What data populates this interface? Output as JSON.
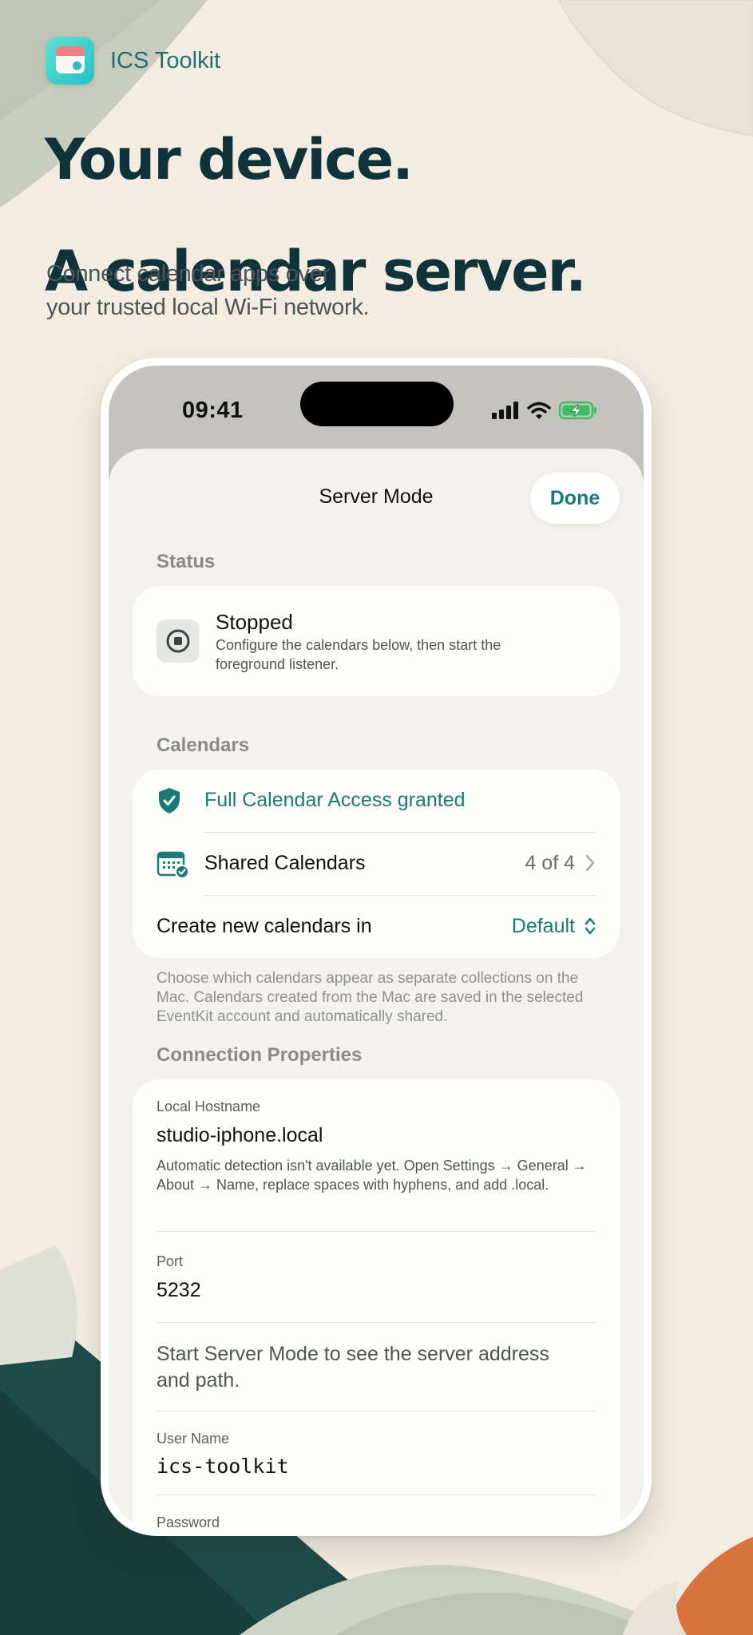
{
  "app": {
    "name": "ICS Toolkit"
  },
  "headline": {
    "line1": "Your device.",
    "line2": "A calendar server."
  },
  "subline": {
    "line1": "Connect calendar apps over",
    "line2": "your trusted local Wi-Fi network."
  },
  "statusbar": {
    "time": "09:41"
  },
  "nav": {
    "title": "Server Mode",
    "done_label": "Done"
  },
  "status_section": {
    "label": "Status",
    "title": "Stopped",
    "description": "Configure the calendars below, then start the foreground listener."
  },
  "calendars_section": {
    "label": "Calendars",
    "access_label": "Full Calendar Access granted",
    "shared_label": "Shared Calendars",
    "shared_value": "4 of 4",
    "create_label": "Create new calendars in",
    "create_value": "Default",
    "footnote": "Choose which calendars appear as separate collections on the Mac. Calendars created from the Mac are saved in the selected EventKit account and automatically shared."
  },
  "connection_section": {
    "label": "Connection Properties",
    "hostname_label": "Local Hostname",
    "hostname_value": "studio-iphone.local",
    "hostname_help": "Automatic detection isn't available yet. Open Settings → General → About → Name, replace spaces with hyphens, and add .local.",
    "port_label": "Port",
    "port_value": "5232",
    "address_help": "Start Server Mode to see the server address and path.",
    "username_label": "User Name",
    "username_value": "ics-toolkit",
    "password_label": "Password"
  },
  "colors": {
    "accent": "#1b7a77",
    "headline": "#103339",
    "background": "#f3ede1"
  }
}
